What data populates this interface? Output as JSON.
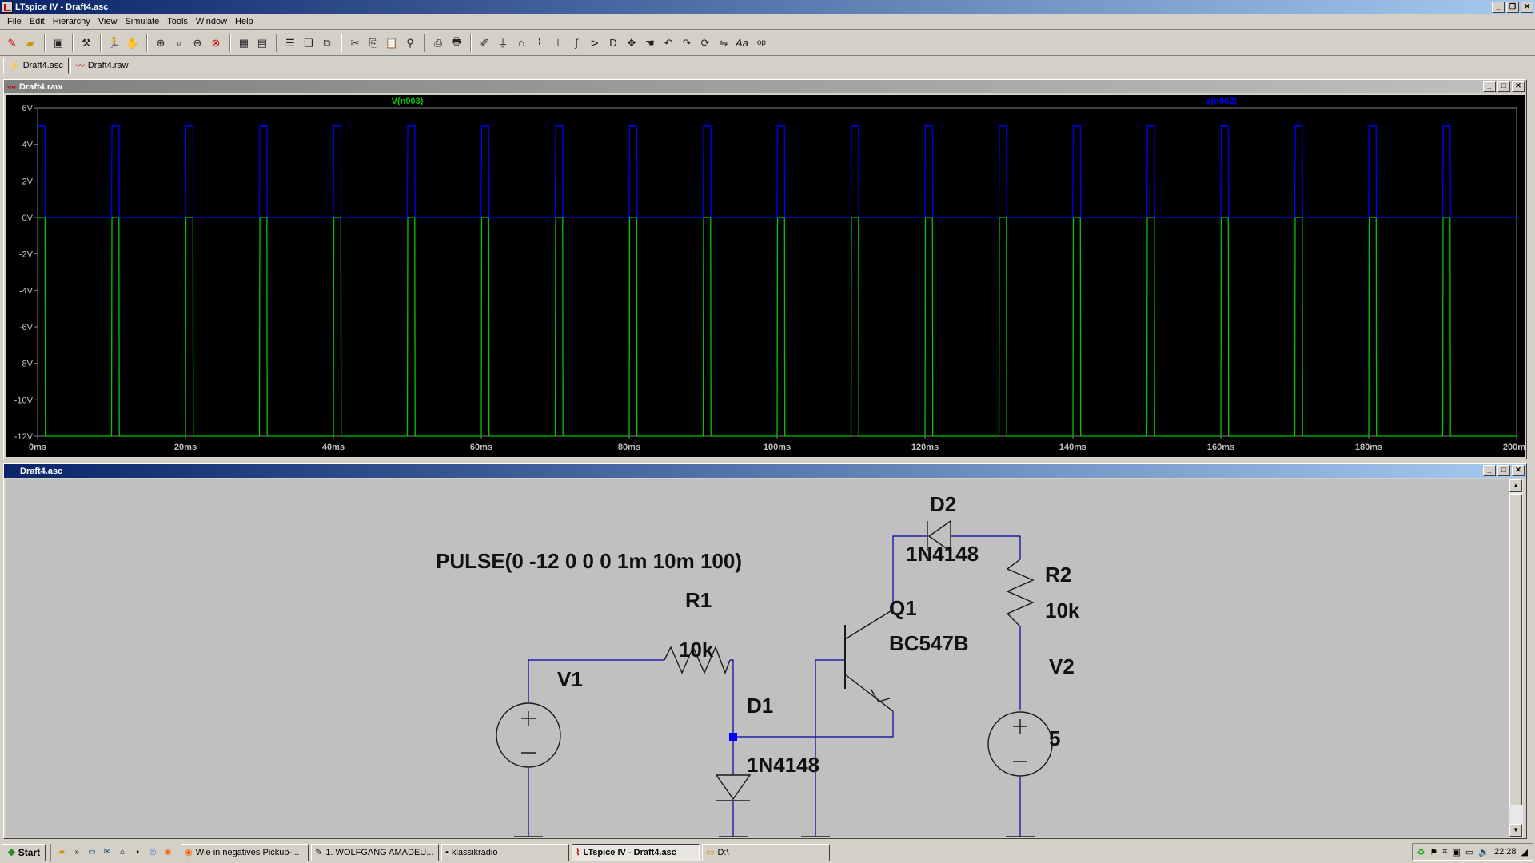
{
  "app": {
    "title": "LTspice IV - Draft4.asc",
    "menu": [
      "File",
      "Edit",
      "Hierarchy",
      "View",
      "Simulate",
      "Tools",
      "Window",
      "Help"
    ],
    "tabs": [
      {
        "label": "Draft4.asc",
        "icon": "schematic-icon"
      },
      {
        "label": "Draft4.raw",
        "icon": "waveform-icon"
      }
    ]
  },
  "waveform_window": {
    "title": "Draft4.raw",
    "traces": [
      {
        "label": "V(n003)",
        "color": "#00c800"
      },
      {
        "label": "V(n002)",
        "color": "#0000ff"
      }
    ]
  },
  "chart_data": {
    "type": "line",
    "title": "",
    "xlabel": "",
    "ylabel": "",
    "x_ticks": [
      "0ms",
      "20ms",
      "40ms",
      "60ms",
      "80ms",
      "100ms",
      "120ms",
      "140ms",
      "160ms",
      "180ms",
      "200ms"
    ],
    "y_ticks": [
      "6V",
      "4V",
      "2V",
      "0V",
      "-2V",
      "-4V",
      "-6V",
      "-8V",
      "-10V",
      "-12V"
    ],
    "xlim": [
      0,
      200
    ],
    "ylim": [
      -12,
      6
    ],
    "grid": false,
    "series": [
      {
        "name": "V(n003)",
        "color": "#00c800",
        "period_ms": 10,
        "pulse_start_ms": 1,
        "pulse_width_ms": 9,
        "high_V": 0,
        "low_V": -12
      },
      {
        "name": "V(n002)",
        "color": "#0000ff",
        "period_ms": 10,
        "pulse_start_ms": 1,
        "pulse_width_ms": 9,
        "high_V": 5,
        "low_V": 0
      }
    ]
  },
  "schematic_window": {
    "title": "Draft4.asc",
    "labels": {
      "pulse": "PULSE(0 -12 0 0 0 1m 10m 100)",
      "r1_name": "R1",
      "r1_value": "10k",
      "r2_name": "R2",
      "r2_value": "10k",
      "v1_name": "V1",
      "v2_name": "V2",
      "v2_value": "5",
      "d1_name": "D1",
      "d1_value": "1N4148",
      "d2_name": "D2",
      "d2_value": "1N4148",
      "q1_name": "Q1",
      "q1_value": "BC547B"
    },
    "wire_color": "#0000a0",
    "component_color": "#1a1a1a"
  },
  "taskbar": {
    "start": "Start",
    "tasks": [
      {
        "label": "Wie in negatives Pickup-...",
        "icon": "firefox-icon",
        "active": false
      },
      {
        "label": "1. WOLFGANG AMADEU...",
        "icon": "music-icon",
        "active": false
      },
      {
        "label": "klassikradio",
        "icon": "cmd-icon",
        "active": false
      },
      {
        "label": "LTspice IV - Draft4.asc",
        "icon": "ltspice-icon",
        "active": true
      },
      {
        "label": "D:\\",
        "icon": "folder-icon",
        "active": false
      }
    ],
    "clock": "22:28"
  }
}
